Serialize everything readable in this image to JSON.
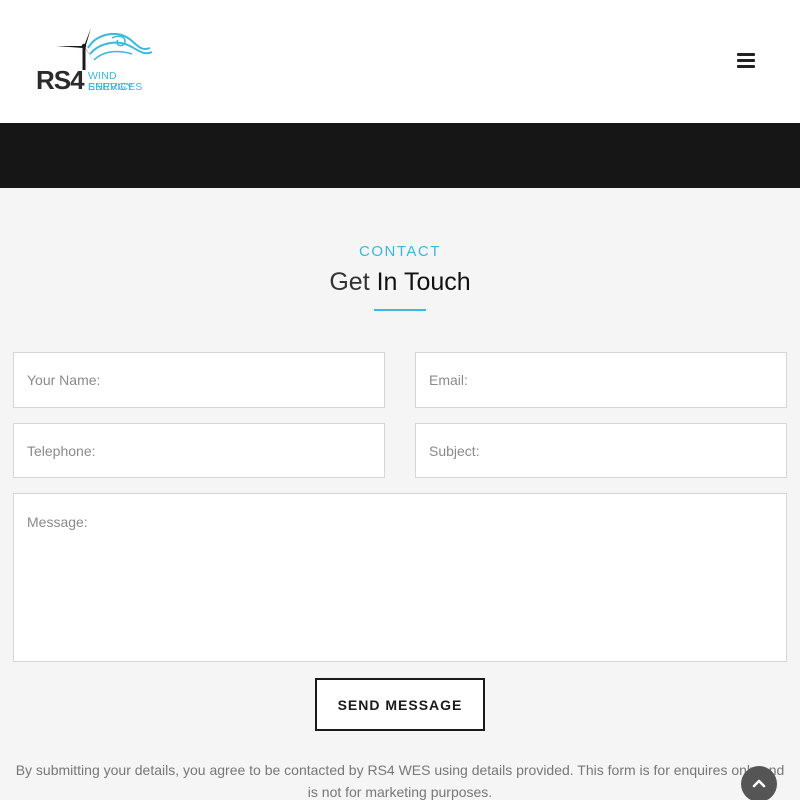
{
  "header": {
    "logo": {
      "brand": "RS4",
      "line1": "WIND ENERGY",
      "line2": "SERVICES"
    },
    "menu_icon": "hamburger-menu-icon"
  },
  "contact": {
    "eyebrow": "CONTACT",
    "heading_light": "Get",
    "heading_bold": "In Touch"
  },
  "form": {
    "name_placeholder": "Your Name:",
    "email_placeholder": "Email:",
    "telephone_placeholder": "Telephone:",
    "subject_placeholder": "Subject:",
    "message_placeholder": "Message:",
    "submit_label": "SEND MESSAGE"
  },
  "disclaimer": "By submitting your details, you agree to be contacted by RS4 WES using details provided. This form is for enquires only and is not for marketing purposes.",
  "colors": {
    "accent": "#3bb7e0",
    "dark_band": "#161616",
    "page_background": "#f5f5f5"
  },
  "scroll_top_icon": "chevron-up-icon"
}
